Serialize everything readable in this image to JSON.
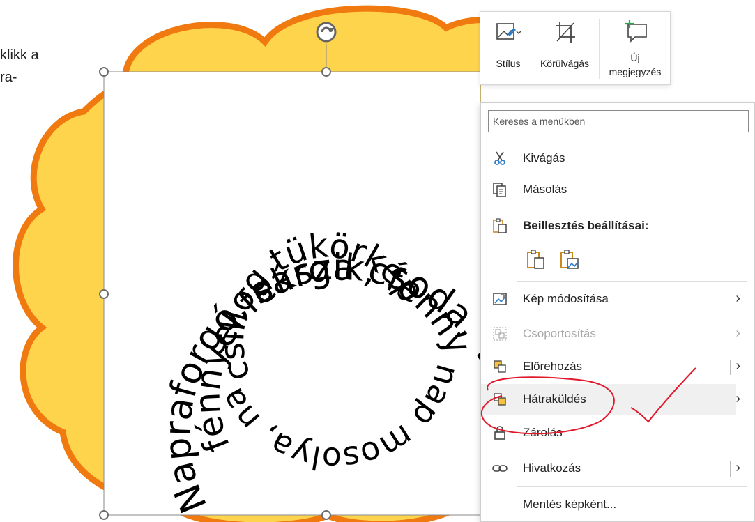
{
  "slide": {
    "side_text_line1": "klikk a",
    "side_text_line2": "ra-",
    "spiral_outer": "Napraforgó, sárga csoda, vidám",
    "spiral_middle": "fénnyel fekszik, fénnyel ebred,",
    "spiral_inner": "csillog tükörképe.",
    "spiral_bottom": "nap mosolya, napban"
  },
  "toolbar": {
    "style_label": "Stílus",
    "crop_label": "Körülvágás",
    "new_comment_line1": "Új",
    "new_comment_line2": "megjegyzés"
  },
  "context_menu": {
    "search_placeholder": "Keresés a menükben",
    "cut": "Kivágás",
    "copy": "Másolás",
    "paste_options": "Beillesztés beállításai:",
    "change_picture": "Kép módosítása",
    "group": "Csoportosítás",
    "bring_forward": "Előrehozás",
    "send_backward": "Hátraküldés",
    "lock": "Zárolás",
    "link": "Hivatkozás",
    "save_as_picture": "Mentés képként..."
  },
  "colors": {
    "cloud_fill": "#FFD44D",
    "cloud_stroke": "#F07A10",
    "annotation": "#E0192C"
  }
}
